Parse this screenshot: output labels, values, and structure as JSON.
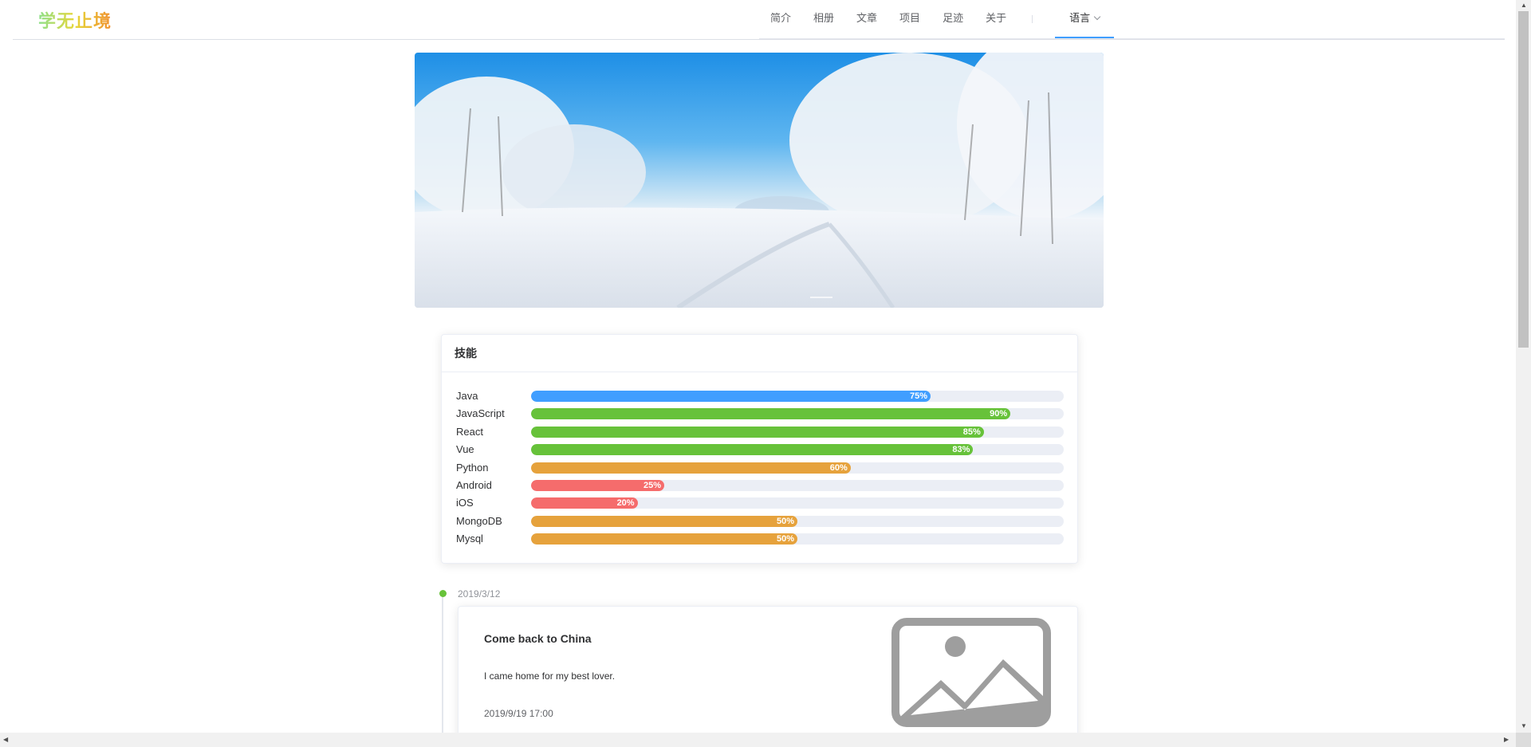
{
  "header": {
    "logo": "学无止境",
    "nav": [
      "简介",
      "相册",
      "文章",
      "项目",
      "足迹",
      "关于"
    ],
    "language_label": "语言"
  },
  "skills": {
    "title": "技能",
    "items": [
      {
        "name": "Java",
        "percent": 75,
        "label": "75%",
        "color": "#409eff"
      },
      {
        "name": "JavaScript",
        "percent": 90,
        "label": "90%",
        "color": "#67c23a"
      },
      {
        "name": "React",
        "percent": 85,
        "label": "85%",
        "color": "#67c23a"
      },
      {
        "name": "Vue",
        "percent": 83,
        "label": "83%",
        "color": "#67c23a"
      },
      {
        "name": "Python",
        "percent": 60,
        "label": "60%",
        "color": "#e6a23c"
      },
      {
        "name": "Android",
        "percent": 25,
        "label": "25%",
        "color": "#f56c6c"
      },
      {
        "name": "iOS",
        "percent": 20,
        "label": "20%",
        "color": "#f56c6c"
      },
      {
        "name": "MongoDB",
        "percent": 50,
        "label": "50%",
        "color": "#e6a23c"
      },
      {
        "name": "Mysql",
        "percent": 50,
        "label": "50%",
        "color": "#e6a23c"
      }
    ]
  },
  "timeline": {
    "date": "2019/3/12",
    "post": {
      "title": "Come back to China",
      "text": "I came home for my best lover.",
      "time": "2019/9/19 17:00",
      "image_icon": "image-placeholder-icon"
    }
  },
  "colors": {
    "accent": "#409eff",
    "timeline_dot": "#67c23a"
  }
}
